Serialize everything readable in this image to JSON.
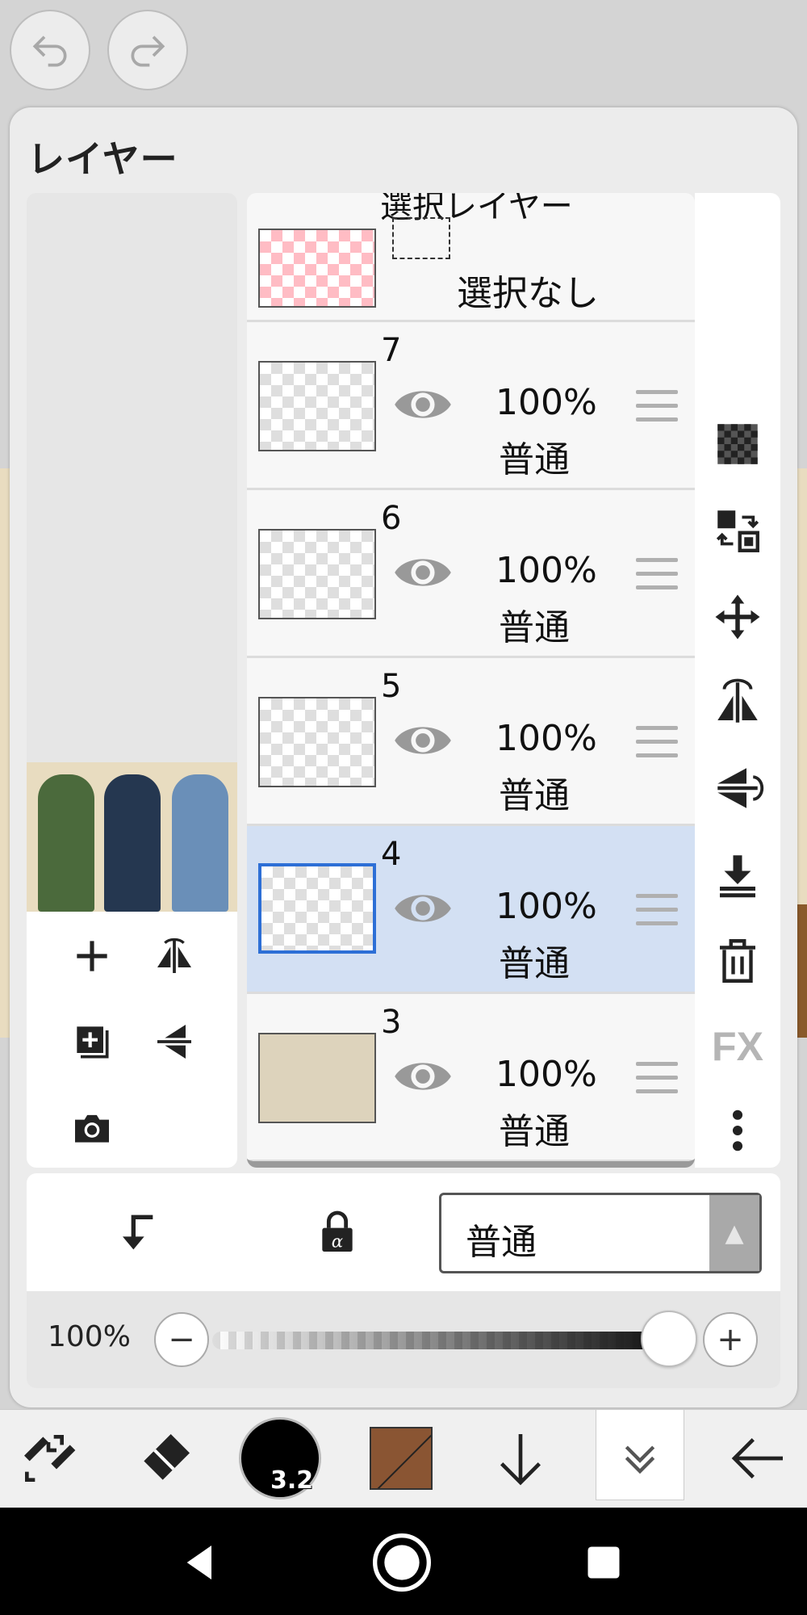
{
  "panel": {
    "title": "レイヤー"
  },
  "selection_layer": {
    "title": "選択レイヤー",
    "status": "選択なし"
  },
  "layers": [
    {
      "number": "7",
      "opacity": "100%",
      "blend": "普通",
      "selected": false
    },
    {
      "number": "6",
      "opacity": "100%",
      "blend": "普通",
      "selected": false
    },
    {
      "number": "5",
      "opacity": "100%",
      "blend": "普通",
      "selected": false
    },
    {
      "number": "4",
      "opacity": "100%",
      "blend": "普通",
      "selected": true
    },
    {
      "number": "3",
      "opacity": "100%",
      "blend": "普通",
      "selected": false
    }
  ],
  "right_tools": {
    "fx_label": "FX"
  },
  "bottom": {
    "blend_mode": "普通",
    "blend_arrow": "▲"
  },
  "opacity_slider": {
    "label": "100%",
    "value": 1.0,
    "minus": "−",
    "plus": "+"
  },
  "toolbar": {
    "brush_size": "3.2",
    "color": "#8a5533"
  },
  "colors": {
    "accent": "#2d6fd6",
    "active_row": "#d3e0f3"
  }
}
